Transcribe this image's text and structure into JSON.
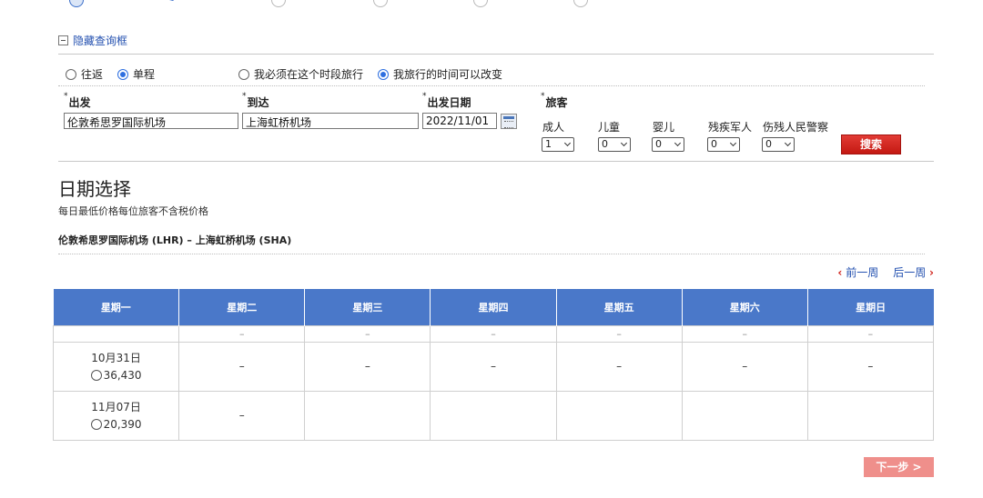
{
  "toggle_query": {
    "label": "隐藏查询框"
  },
  "trip_type": {
    "round_trip": "往返",
    "one_way": "单程",
    "selected": "one_way"
  },
  "time_flex": {
    "fixed": "我必须在这个时段旅行",
    "flexible": "我旅行的时间可以改变",
    "selected": "flexible"
  },
  "form": {
    "required_mark": "*",
    "from_label": "出发",
    "from_value": "伦敦希思罗国际机场",
    "to_label": "到达",
    "to_value": "上海虹桥机场",
    "date_label": "出发日期",
    "date_value": "2022/11/01",
    "pax_label": "旅客",
    "pax": [
      {
        "label": "成人",
        "value": "1"
      },
      {
        "label": "儿童",
        "value": "0"
      },
      {
        "label": "婴儿",
        "value": "0"
      },
      {
        "label": "残疾军人",
        "value": "0"
      },
      {
        "label": "伤残人民警察",
        "value": "0"
      }
    ],
    "search_label": "搜索"
  },
  "section": {
    "title": "日期选择",
    "note": "每日最低价格每位旅客不含税价格",
    "route": "伦敦希思罗国际机场 (LHR) – 上海虹桥机场 (SHA)"
  },
  "week_nav": {
    "prev": "前一周",
    "next": "后一周",
    "prev_arrow": "‹",
    "next_arrow": "›"
  },
  "calendar": {
    "headers": [
      "星期一",
      "星期二",
      "星期三",
      "星期四",
      "星期五",
      "星期六",
      "星期日"
    ],
    "dash": "–",
    "row1": {
      "date": "10月31日",
      "price": "36,430"
    },
    "row2": {
      "date": "11月07日",
      "price": "20,390"
    }
  },
  "next_button": {
    "label": "下一步 >"
  },
  "colors": {
    "header_blue": "#4a78c9",
    "search_red": "#d0211a",
    "next_pink": "#ef8f8b",
    "link_blue": "#2451b0"
  }
}
